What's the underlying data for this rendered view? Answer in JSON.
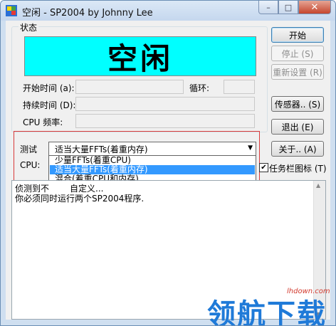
{
  "window": {
    "title": "空闲 - SP2004 by Johnny Lee",
    "min_glyph": "–",
    "max_glyph": "□",
    "close_glyph": "✕"
  },
  "status": {
    "group_label": "状态",
    "state": "空闲",
    "state_bg": "#00ffff",
    "start_time_label": "开始时间 (a):",
    "cycle_label": "循环:",
    "duration_label": "持续时间 (D):",
    "cpu_freq_label": "CPU 频率:"
  },
  "buttons": {
    "start": "开始",
    "stop": "停止 (S)",
    "reset": "重新设置 (R)",
    "sensor": "传感器.. (S)",
    "exit": "退出 (E)",
    "about": "关于.. (A)"
  },
  "test": {
    "label": "测试",
    "selected": "适当大量FFTs(着重内存)",
    "options": [
      "少量FFTs(着重CPU)",
      "适当大量FFTs(着重内存)",
      "混合(着重CPU和内存)",
      "自定义..."
    ],
    "selected_index": 1
  },
  "cpu_label": "CPU:",
  "tray_checkbox": {
    "label": "任务栏图标 (T)",
    "checked": true
  },
  "log": {
    "lines": [
      "侦测到不",
      "你必须同时运行两个SP2004程序."
    ]
  },
  "watermark": {
    "text": "领航下载",
    "url": "lhdown.com"
  }
}
